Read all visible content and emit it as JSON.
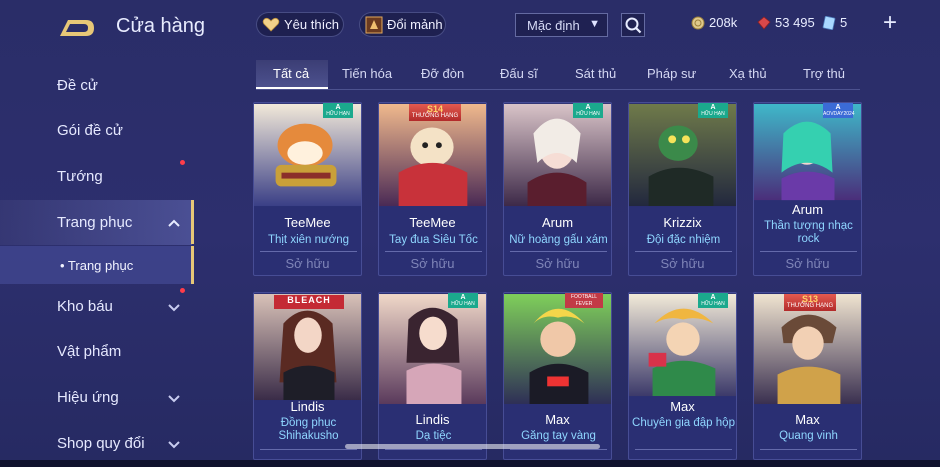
{
  "header": {
    "title": "Cửa hàng",
    "favorite_label": "Yêu thích",
    "shard_label": "Đổi mảnh",
    "sort_value": "Mặc định",
    "gold": "208k",
    "gems": "53 495",
    "vouchers": "5",
    "plus_label": "+"
  },
  "sidebar": {
    "items": [
      {
        "label": "Đề cử"
      },
      {
        "label": "Gói đề cử"
      },
      {
        "label": "Tướng"
      },
      {
        "label": "Trang phục"
      },
      {
        "label": "Kho báu"
      },
      {
        "label": "Vật phẩm"
      },
      {
        "label": "Hiệu ứng"
      },
      {
        "label": "Shop quy đổi"
      }
    ],
    "sub_item": "• Trang phục"
  },
  "tabs": [
    "Tất cả",
    "Tiến hóa",
    "Đỡ đòn",
    "Đấu sĩ",
    "Sát thủ",
    "Pháp sư",
    "Xạ thủ",
    "Trợ thủ"
  ],
  "badges": {
    "limited_a": "A",
    "limited_text": "HỮU HẠN",
    "ranked_text": "THƯỞNG HẠNG",
    "s14": "S14",
    "s13": "S13",
    "aov_day": "AOVDAY2024",
    "bleach": "BLEACH",
    "football": "FOOTBALL FEVER"
  },
  "cards_row1": [
    {
      "hero": "TeeMee",
      "skin": "Thịt xiên nướng",
      "status": "Sở hữu"
    },
    {
      "hero": "TeeMee",
      "skin": "Tay đua Siêu Tốc",
      "status": "Sở hữu"
    },
    {
      "hero": "Arum",
      "skin": "Nữ hoàng gấu xám",
      "status": "Sở hữu"
    },
    {
      "hero": "Krizzix",
      "skin": "Đội đặc nhiệm",
      "status": "Sở hữu"
    },
    {
      "hero": "Arum",
      "skin": "Thần tượng nhạc rock",
      "status": "Sở hữu"
    }
  ],
  "cards_row2": [
    {
      "hero": "Lindis",
      "skin": "Đồng phục Shihakusho"
    },
    {
      "hero": "Lindis",
      "skin": "Dạ tiệc"
    },
    {
      "hero": "Max",
      "skin": "Găng tay vàng"
    },
    {
      "hero": "Max",
      "skin": "Chuyên gia đập hộp"
    },
    {
      "hero": "Max",
      "skin": "Quang vinh"
    }
  ],
  "colors": {
    "accent": "#e7c777",
    "skin_text": "#8fd6ff",
    "notify": "#ff3d4a"
  }
}
